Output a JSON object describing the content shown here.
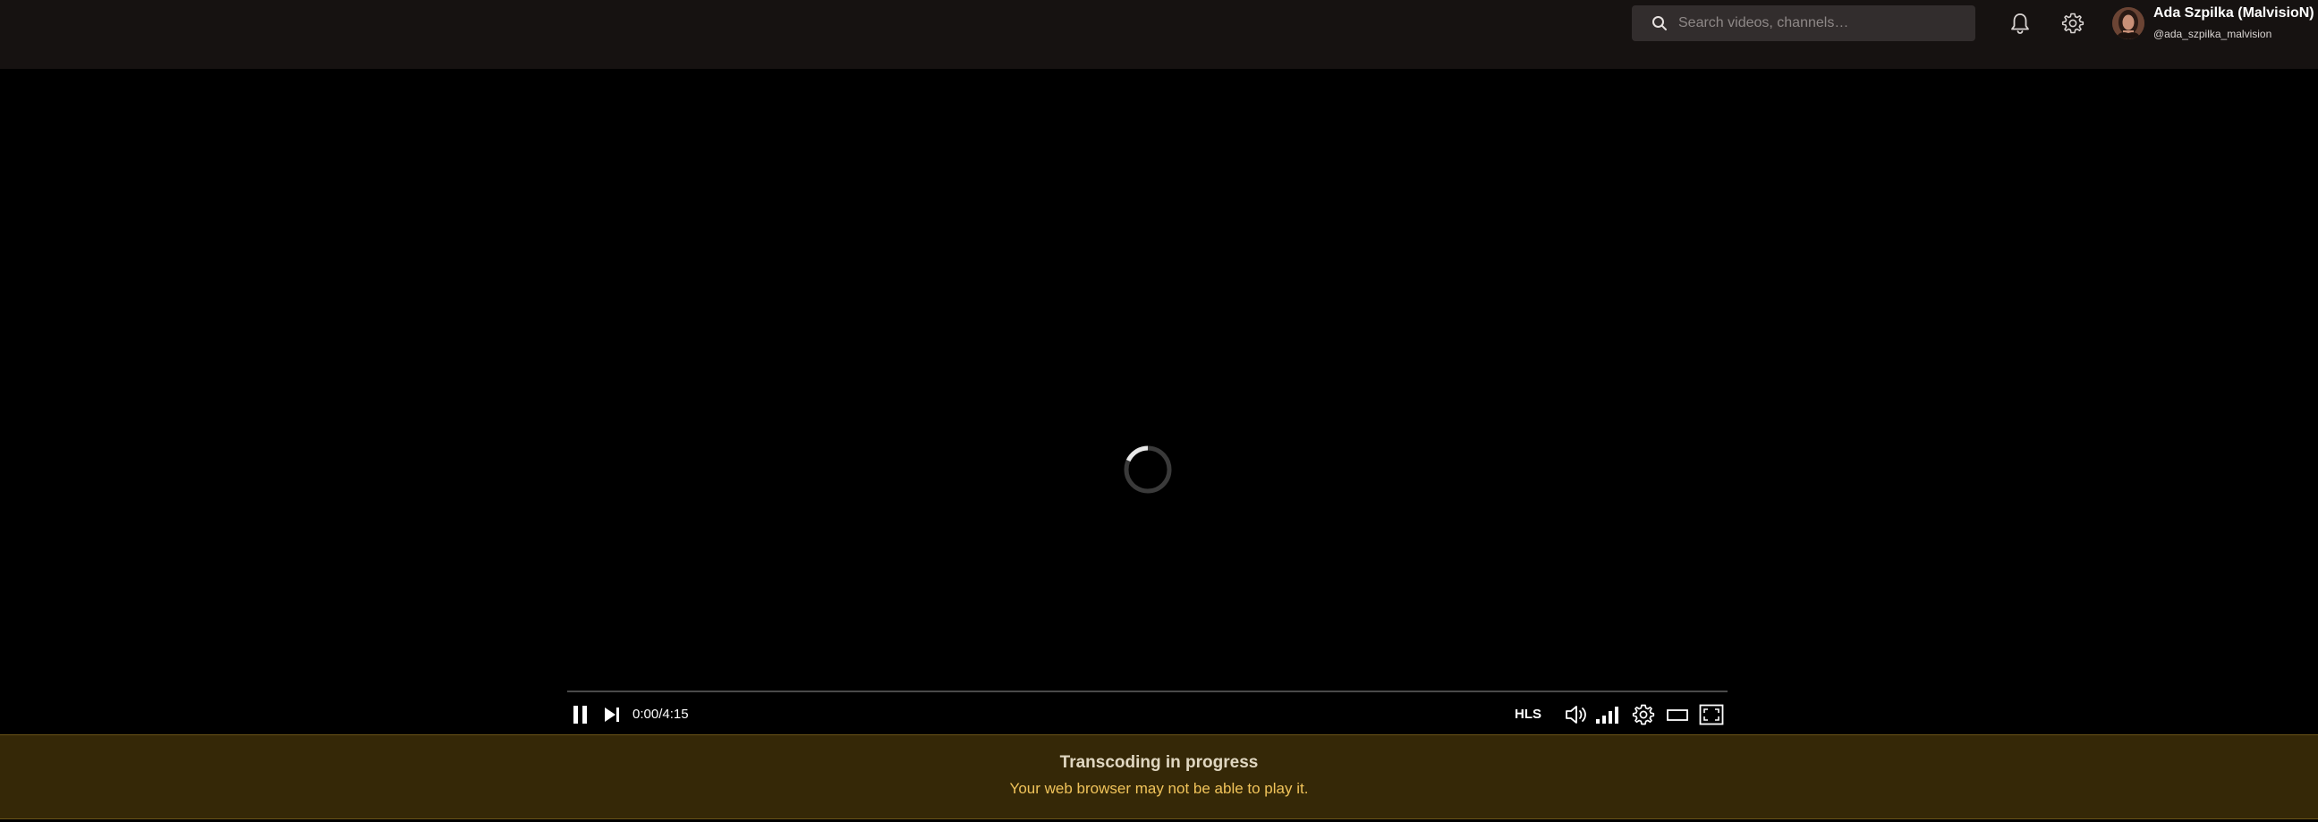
{
  "header": {
    "search": {
      "placeholder": "Search videos, channels…",
      "value": ""
    },
    "icons": {
      "search": "search-icon",
      "notifications": "bell-icon",
      "settings": "gear-icon"
    },
    "user": {
      "display_name": "Ada Szpilka (MalvisioN)",
      "handle": "@ada_szpilka_malvision"
    }
  },
  "player": {
    "state": "loading",
    "time": {
      "current": "0:00",
      "separator": "/",
      "duration": "4:15"
    },
    "progress": 0,
    "stream_format": "HLS",
    "controls": [
      "pause-icon",
      "next-icon",
      "volume-icon",
      "signal-bars-icon",
      "gear-icon",
      "theater-mode-icon",
      "fullscreen-icon"
    ]
  },
  "banner": {
    "title": "Transcoding in progress",
    "message": "Your web browser may not be able to play it."
  },
  "colors": {
    "header_bg": "#161211",
    "search_bg": "#322d2d",
    "banner_bg": "#352807",
    "banner_text": "#f0c35a",
    "banner_title": "#e0d7c1"
  }
}
